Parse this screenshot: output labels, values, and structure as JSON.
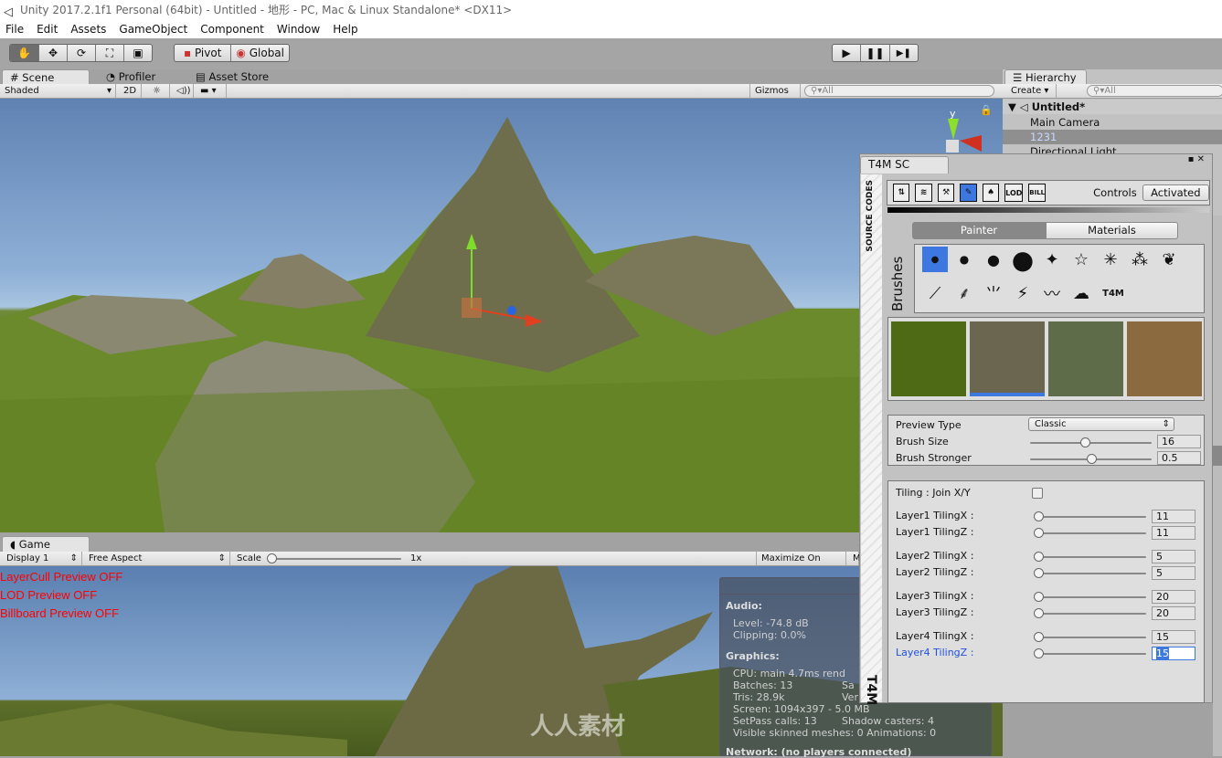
{
  "window": {
    "title": "Unity 2017.2.1f1 Personal (64bit) - Untitled - 地形 - PC, Mac & Linux Standalone* <DX11>"
  },
  "menu": [
    "File",
    "Edit",
    "Assets",
    "GameObject",
    "Component",
    "Window",
    "Help"
  ],
  "toolbar": {
    "tools": [
      "hand-tool",
      "move-tool",
      "rotate-tool",
      "scale-tool",
      "rect-tool"
    ],
    "pivot": "Pivot",
    "global": "Global",
    "play": "▶",
    "pause": "❚❚",
    "step": "▶❚"
  },
  "scene": {
    "tabs": [
      "Scene",
      "Profiler",
      "Asset Store"
    ],
    "shading": "Shaded",
    "mode2d": "2D",
    "gizmos": "Gizmos",
    "search_placeholder": "All",
    "axis_y": "y",
    "axis_x": "x"
  },
  "game": {
    "tab": "Game",
    "display": "Display 1",
    "aspect": "Free Aspect",
    "scale_label": "Scale",
    "scale_value": "1x",
    "maximize": "Maximize On Play",
    "more": "M",
    "overlay": [
      "LayerCull Preview OFF",
      "LOD Preview OFF",
      "Billboard Preview OFF"
    ]
  },
  "stats": {
    "title": "Statis",
    "audio_h": "Audio:",
    "level": "Level: -74.8 dB",
    "clipping": "Clipping: 0.0%",
    "graphics_h": "Graphics:",
    "cpu": "CPU: main 4.7ms  rend",
    "batches": "Batches: 13",
    "tris": "Tris: 28.9k",
    "saved": "Sa",
    "verts": "Ver",
    "screen": "Screen: 1094x397 - 5.0 MB",
    "setpass": "SetPass calls: 13",
    "shadow": "Shadow casters: 4",
    "skinned": "Visible skinned meshes: 0  Animations: 0",
    "network": "Network: (no players connected)"
  },
  "hierarchy": {
    "tab": "Hierarchy",
    "create": "Create",
    "search_placeholder": "All",
    "scene": "Untitled*",
    "items": [
      "Main Camera",
      "1231",
      "Directional Light"
    ]
  },
  "t4m": {
    "title": "T4M SC",
    "side_label": "SOURCE CODES",
    "side_logo": "T4M",
    "tool_icons": [
      "⇅",
      "≋",
      "⚒",
      "✎",
      "♠",
      "LOD",
      "BILL"
    ],
    "controls": "Controls",
    "activated": "Activated",
    "tabs": [
      "Painter",
      "Materials"
    ],
    "brushes_label": "Brushes",
    "brush_logo": "T4M",
    "preview_type_label": "Preview Type",
    "preview_type": "Classic",
    "brush_size_label": "Brush Size",
    "brush_size": "16",
    "brush_size_frac": 0.45,
    "brush_strong_label": "Brush Stronger",
    "brush_strong": "0.5",
    "brush_strong_frac": 0.5,
    "tiling_join_label": "Tiling : Join X/Y",
    "tiling_join": false,
    "layers": [
      {
        "label": "Layer1 TilingX :",
        "value": "11"
      },
      {
        "label": "Layer1 TilingZ :",
        "value": "11"
      },
      {
        "label": "Layer2 TilingX :",
        "value": "5"
      },
      {
        "label": "Layer2 TilingZ :",
        "value": "5"
      },
      {
        "label": "Layer3 TilingX :",
        "value": "20"
      },
      {
        "label": "Layer3 TilingZ :",
        "value": "20"
      },
      {
        "label": "Layer4 TilingX :",
        "value": "15"
      },
      {
        "label": "Layer4 TilingZ :",
        "value": "15"
      }
    ],
    "accent": "#3c78e0"
  },
  "watermark": "人人素材"
}
